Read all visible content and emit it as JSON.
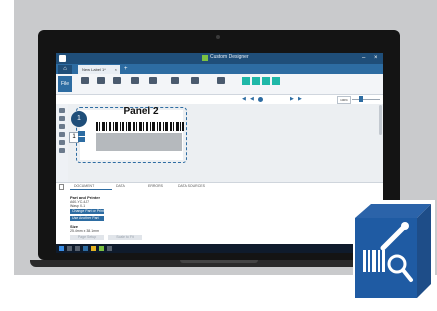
{
  "app": {
    "title": "Custom Designer"
  },
  "tabs": {
    "home_icon": "home-icon",
    "document_tab": "New Label 1*"
  },
  "designer": {
    "panel_title": "Panel 2",
    "panel_number": "1",
    "panel_counter": "1",
    "zoom_value": "100%"
  },
  "bottom_panel": {
    "tabs": [
      "DOCUMENT",
      "DATA",
      "ERRORS",
      "DATA SOURCES"
    ],
    "active_tab": "DOCUMENT",
    "printer_header": "Part and Printer",
    "part_number": "A60-YC-4J7",
    "printer_model": "Wasp X-1",
    "change_part_button": "Change Part or Printer",
    "use_another_button": "Use Another Part",
    "size_header": "Size",
    "size_value": "25.4mm x 38.1mm",
    "disabled_buttons": [
      "Page Setup",
      "Scale to Fit"
    ]
  },
  "colors": {
    "accent": "#2d6ca2",
    "titlebar": "#1f4e79",
    "brand_green": "#7cc242",
    "taskbar": "#0f1b2c"
  }
}
